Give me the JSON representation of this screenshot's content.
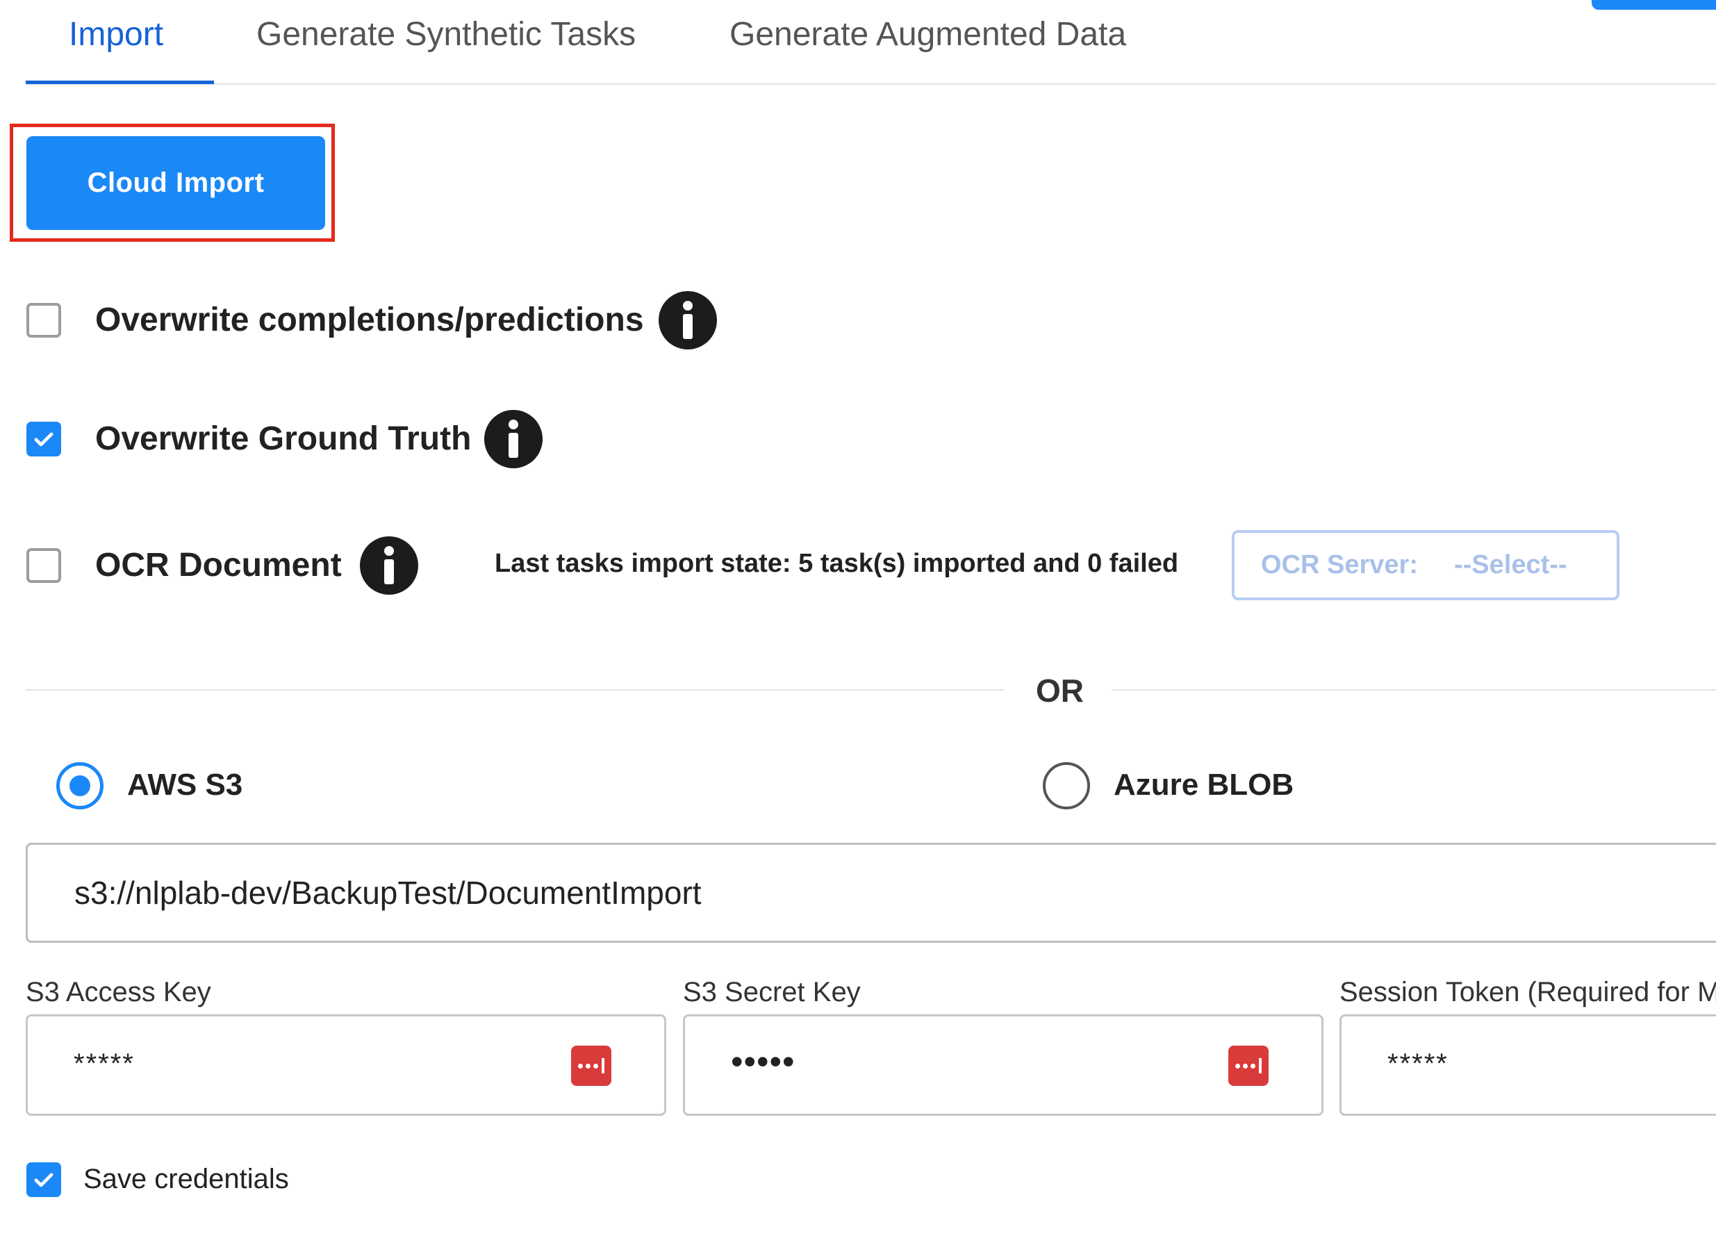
{
  "tabs": [
    {
      "label": "Import",
      "active": true
    },
    {
      "label": "Generate Synthetic Tasks",
      "active": false
    },
    {
      "label": "Generate Augmented Data",
      "active": false
    }
  ],
  "cloud_import_label": "Cloud Import",
  "options": [
    {
      "label": "Overwrite completions/predictions",
      "checked": false
    },
    {
      "label": "Overwrite Ground Truth",
      "checked": true
    },
    {
      "label": "OCR Document",
      "checked": false
    }
  ],
  "status_text": "Last tasks import state: 5 task(s) imported and 0 failed",
  "ocr_server": {
    "label": "OCR Server:",
    "value": "--Select--"
  },
  "or_text": "OR",
  "sources": [
    {
      "label": "AWS S3",
      "selected": true
    },
    {
      "label": "Azure BLOB",
      "selected": false
    }
  ],
  "path_value": "s3://nlplab-dev/BackupTest/DocumentImport",
  "fields": {
    "access_key": {
      "label": "S3 Access Key",
      "value": "*****"
    },
    "secret_key": {
      "label": "S3 Secret Key",
      "value": "•••••"
    },
    "session_token": {
      "label": "Session Token (Required for MF",
      "value": "*****"
    }
  },
  "save_credentials": {
    "label": "Save credentials",
    "checked": true
  },
  "colors": {
    "accent": "#1a88f7",
    "highlight": "#e52a1c",
    "password_icon": "#d93a3a"
  }
}
